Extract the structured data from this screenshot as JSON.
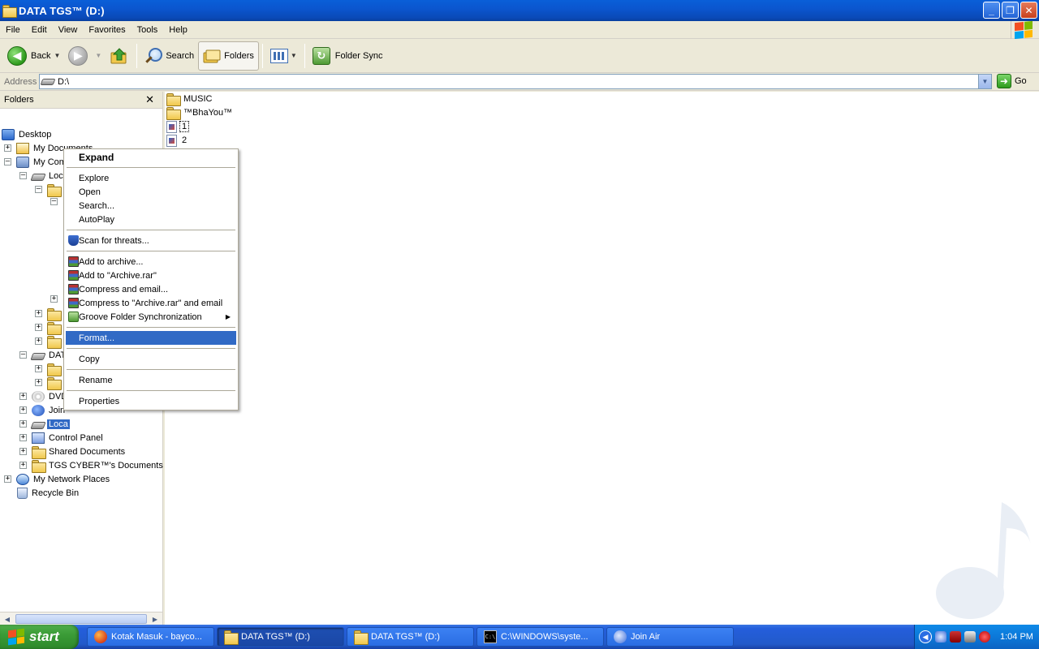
{
  "window": {
    "title": "DATA TGS™ (D:)",
    "caption_buttons": {
      "minimize": "_",
      "maximize": "❐",
      "close": "✕"
    }
  },
  "menubar": {
    "items": [
      "File",
      "Edit",
      "View",
      "Favorites",
      "Tools",
      "Help"
    ]
  },
  "toolbar": {
    "back_label": "Back",
    "search_label": "Search",
    "folders_label": "Folders",
    "folder_sync_label": "Folder Sync"
  },
  "address": {
    "label": "Address",
    "value": "D:\\",
    "go_label": "Go"
  },
  "folders_pane": {
    "header": "Folders",
    "close_glyph": "✕",
    "tree": {
      "desktop": "Desktop",
      "my_documents": "My Documents",
      "my_computer": "My Computer",
      "local_disk_c": "Loca",
      "data_drive": "DAT",
      "dvd_drive": "DVD",
      "join_air": "Join",
      "local_disk_sel": "Loca",
      "control_panel": "Control Panel",
      "shared_documents": "Shared Documents",
      "tgs_documents": "TGS CYBER™'s Documents",
      "my_network_places": "My Network Places",
      "recycle_bin": "Recycle Bin"
    }
  },
  "content": {
    "files": [
      "MUSIC",
      "™BhaYou™",
      "1",
      "2"
    ]
  },
  "context_menu": {
    "expand": "Expand",
    "explore": "Explore",
    "open": "Open",
    "search": "Search...",
    "autoplay": "AutoPlay",
    "scan": "Scan for threats...",
    "add_archive": "Add to archive...",
    "add_archive_rar": "Add to \"Archive.rar\"",
    "compress_email": "Compress and email...",
    "compress_rar_email": "Compress to \"Archive.rar\" and email",
    "groove_sync": "Groove Folder Synchronization",
    "format": "Format...",
    "copy": "Copy",
    "rename": "Rename",
    "properties": "Properties"
  },
  "taskbar": {
    "start_label": "start",
    "tasks": [
      {
        "label": "Kotak Masuk - bayco...",
        "icon": "firefox-icon"
      },
      {
        "label": "DATA TGS™ (D:)",
        "icon": "folder-icon",
        "active": true
      },
      {
        "label": "DATA TGS™ (D:)",
        "icon": "folder-icon"
      },
      {
        "label": "C:\\WINDOWS\\syste...",
        "icon": "cmd-icon"
      },
      {
        "label": "Join Air",
        "icon": "join-air-icon"
      }
    ],
    "clock": "1:04 PM"
  },
  "colors": {
    "titlebar": "#0b56cf",
    "selection": "#316ac5",
    "taskbar": "#245edc",
    "start_button": "#3b9c37"
  }
}
